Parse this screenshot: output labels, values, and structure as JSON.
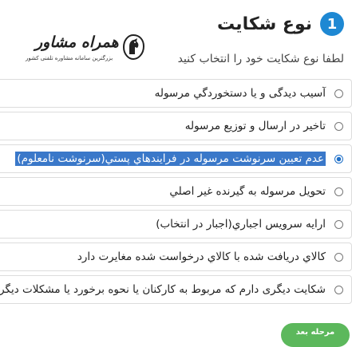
{
  "header": {
    "step_number": "1",
    "title": "نوع شکایت"
  },
  "logo": {
    "brand": "همراه مشاور",
    "tagline": "بزرگترین سامانه مشاوره تلفنی کشور",
    "icon": "horse-emblem-icon"
  },
  "subtitle": "لطفا نوع شکایت خود را انتخاب کنید",
  "options": [
    {
      "label": "آسیب دیدگی و یا دستخوردگي مرسوله",
      "selected": false
    },
    {
      "label": "تاخیر در ارسال و توزیع مرسوله",
      "selected": false
    },
    {
      "label": "عدم تعیین سرنوشت مرسوله در فرایندهاي پستي(سرنوشت نامعلوم)",
      "selected": true
    },
    {
      "label": "تحویل مرسوله به گیرنده غیر اصلي",
      "selected": false
    },
    {
      "label": "ارايه سرويس اجباري(اجبار در انتخاب)",
      "selected": false
    },
    {
      "label": "کالاي دريافت شده با کالاي درخواست شده مغايرت دارد",
      "selected": false
    },
    {
      "label": "شکایت دیگری دارم که مربوط به کارکنان یا نحوه برخورد یا مشکلات دیگر است",
      "selected": false
    }
  ],
  "next_button": {
    "label": "مرحله بعد"
  },
  "colors": {
    "accent": "#1e88d3",
    "selection": "#3a78c9",
    "button": "#5cb85c"
  }
}
